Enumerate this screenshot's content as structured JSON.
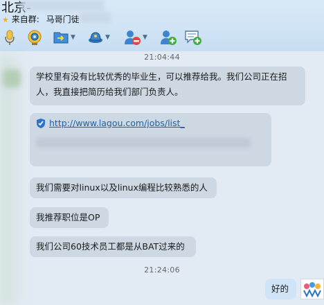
{
  "header": {
    "title": "北京-",
    "source_label": "来自群:",
    "group_name": "马哥门徒"
  },
  "toolbar": {
    "icons": [
      "microphone-icon",
      "camera-icon",
      "folder-transfer-icon",
      "app-hat-icon",
      "remove-user-icon",
      "add-user-icon",
      "new-message-icon"
    ]
  },
  "messages": {
    "ts1": "21:04:44",
    "m1": "学校里有没有比较优秀的毕业生，可以推荐给我。我们公司正在招人，我直接把简历给我们部门负责人。",
    "m2_link": "http://www.lagou.com/jobs/list_",
    "m3": "我们需要对linux以及linux编程比较熟悉的人",
    "m4": "我推荐职位是OP",
    "m5": "我们公司60技术员工都是从BAT过来的",
    "ts2": "21:24:06",
    "reply": "好的"
  },
  "colors": {
    "header_bg": "#cfe3f5",
    "chat_bg": "#e2ebf3",
    "bubble_other": "#cdd8e3",
    "bubble_self": "#cfe4f6",
    "link": "#1f5fae"
  }
}
